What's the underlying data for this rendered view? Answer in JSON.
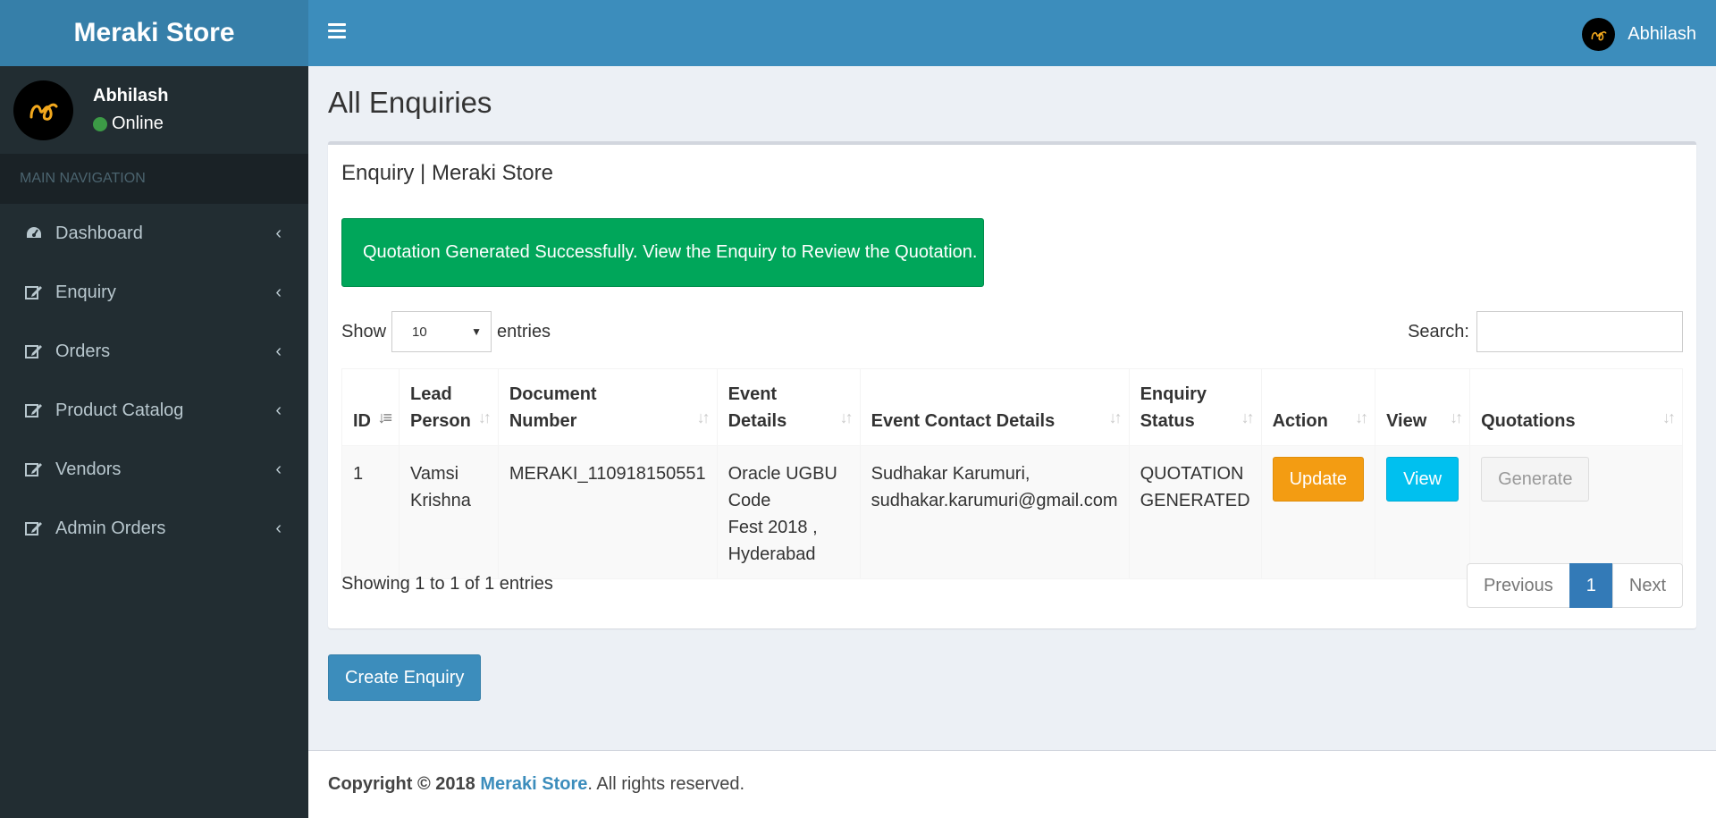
{
  "app": {
    "brand": "Meraki Store"
  },
  "user": {
    "name": "Abhilash",
    "status": "Online"
  },
  "sidebar": {
    "header": "MAIN NAVIGATION",
    "items": [
      {
        "label": "Dashboard",
        "icon": "dashboard-icon"
      },
      {
        "label": "Enquiry",
        "icon": "edit-icon"
      },
      {
        "label": "Orders",
        "icon": "edit-icon"
      },
      {
        "label": "Product Catalog",
        "icon": "edit-icon"
      },
      {
        "label": "Vendors",
        "icon": "edit-icon"
      },
      {
        "label": "Admin Orders",
        "icon": "edit-icon"
      }
    ]
  },
  "page": {
    "title": "All Enquiries",
    "box_title": "Enquiry | Meraki Store",
    "alert": "Quotation Generated Successfully. View the Enquiry to Review the Quotation."
  },
  "table_controls": {
    "show_label": "Show",
    "entries_label": "entries",
    "page_length": "10",
    "search_label": "Search:"
  },
  "table": {
    "headers": {
      "id": "ID",
      "lead_person_1": "Lead",
      "lead_person_2": "Person",
      "doc_number_1": "Document",
      "doc_number_2": "Number",
      "event_details": "Event Details",
      "event_contact": "Event Contact Details",
      "status_1": "Enquiry",
      "status_2": "Status",
      "action": "Action",
      "view": "View",
      "quotations": "Quotations"
    },
    "rows": [
      {
        "id": "1",
        "lead_1": "Vamsi",
        "lead_2": "Krishna",
        "doc_number": "MERAKI_110918150551",
        "event_1": "Oracle UGBU Code",
        "event_2": "Fest 2018 ,",
        "event_3": "Hyderabad",
        "contact_1": "Sudhakar Karumuri,",
        "contact_2": "sudhakar.karumuri@gmail.com",
        "status_1": "QUOTATION",
        "status_2": "GENERATED",
        "update_label": "Update",
        "view_label": "View",
        "generate_label": "Generate"
      }
    ]
  },
  "pagination": {
    "info": "Showing 1 to 1 of 1 entries",
    "previous": "Previous",
    "current": "1",
    "next": "Next"
  },
  "create_button": "Create Enquiry",
  "footer": {
    "copyright": "Copyright © 2018",
    "brand": "Meraki Store",
    "rest": ". All rights reserved."
  },
  "colors": {
    "header": "#3c8dbc",
    "logo_bg": "#367fa9",
    "sidebar": "#222d32",
    "success": "#00a65a",
    "warning": "#f39c12",
    "info": "#00c0ef"
  }
}
